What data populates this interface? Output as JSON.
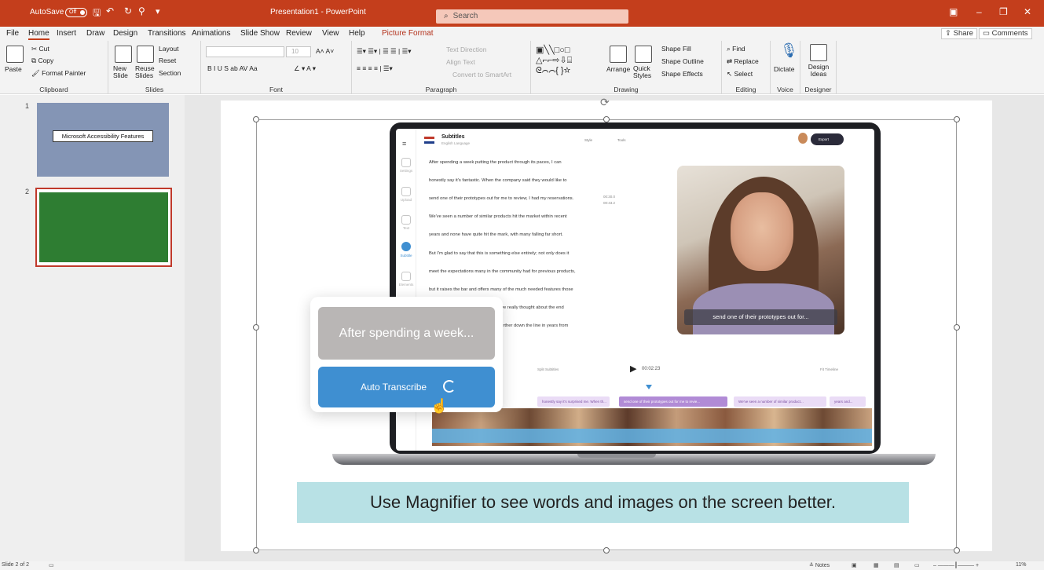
{
  "titlebar": {
    "autosave_label": "AutoSave",
    "autosave_state": "Off",
    "doc_title": "Presentation1 - PowerPoint",
    "search_placeholder": "Search"
  },
  "menu": {
    "tabs": [
      "File",
      "Home",
      "Insert",
      "Draw",
      "Design",
      "Transitions",
      "Animations",
      "Slide Show",
      "Review",
      "View",
      "Help",
      "Picture Format"
    ],
    "active": "Home",
    "share": "Share",
    "comments": "Comments"
  },
  "ribbon": {
    "clipboard": {
      "paste": "Paste",
      "cut": "Cut",
      "copy": "Copy",
      "format_painter": "Format Painter",
      "label": "Clipboard"
    },
    "slides": {
      "new_slide": "New Slide",
      "reuse_slides": "Reuse Slides",
      "layout": "Layout",
      "reset": "Reset",
      "section": "Section",
      "label": "Slides"
    },
    "font": {
      "size": "10",
      "label": "Font"
    },
    "paragraph": {
      "text_direction": "Text Direction",
      "align_text": "Align Text",
      "convert_smartart": "Convert to SmartArt",
      "label": "Paragraph"
    },
    "drawing": {
      "arrange": "Arrange",
      "quick_styles": "Quick Styles",
      "shape_fill": "Shape Fill",
      "shape_outline": "Shape Outline",
      "shape_effects": "Shape Effects",
      "label": "Drawing"
    },
    "editing": {
      "find": "Find",
      "replace": "Replace",
      "select": "Select",
      "label": "Editing"
    },
    "voice": {
      "dictate": "Dictate",
      "label": "Voice"
    },
    "designer": {
      "design_ideas": "Design Ideas",
      "label": "Designer"
    }
  },
  "thumbnails": [
    {
      "number": "1",
      "label": "Microsoft Accessibility Features"
    },
    {
      "number": "2"
    }
  ],
  "slide": {
    "app": {
      "title": "Subtitles",
      "subtitle": "English Language",
      "style": "Style",
      "tools": "Tools",
      "export": "Export",
      "time_in": "00:30.0",
      "time_out": "00:43.2",
      "side_items": [
        "Settings",
        "Upload",
        "Text",
        "Subtitle",
        "Elements"
      ],
      "subtitle_lines": [
        "After spending a week putting the product through its paces, I can",
        "honestly say it's fantastic. When the company said they would like to",
        "send one of their prototypes out for me to review, I had my reservations.",
        "We've seen a number of similar products hit the market within recent",
        "years and none have quite hit the mark, with many falling far short.",
        "But I'm glad to say that this is something else entirely; not only does it",
        "meet the expectations many in the community had for previous products,",
        "but it raises the bar and offers many of the much needed features those",
        "they've really thought about the end",
        "out further down the line in years from"
      ],
      "video_caption": "send one of their prototypes out for...",
      "timeline": {
        "split": "Split Subtitles",
        "time": "00:02:23",
        "fit": "Fit Timeline"
      },
      "clips": [
        "honestly say it's surprised me. When th...",
        "send one of their prototypes out for me to revie...",
        "We've seen a number of similar product...",
        "years and..."
      ]
    },
    "overlay": {
      "preview_text": "After spending a week...",
      "button_label": "Auto Transcribe"
    },
    "caption": "Use Magnifier to see words and images on the screen better."
  },
  "statusbar": {
    "slide_of": "Slide 2 of 2",
    "notes": "Notes",
    "zoom": "11%"
  }
}
